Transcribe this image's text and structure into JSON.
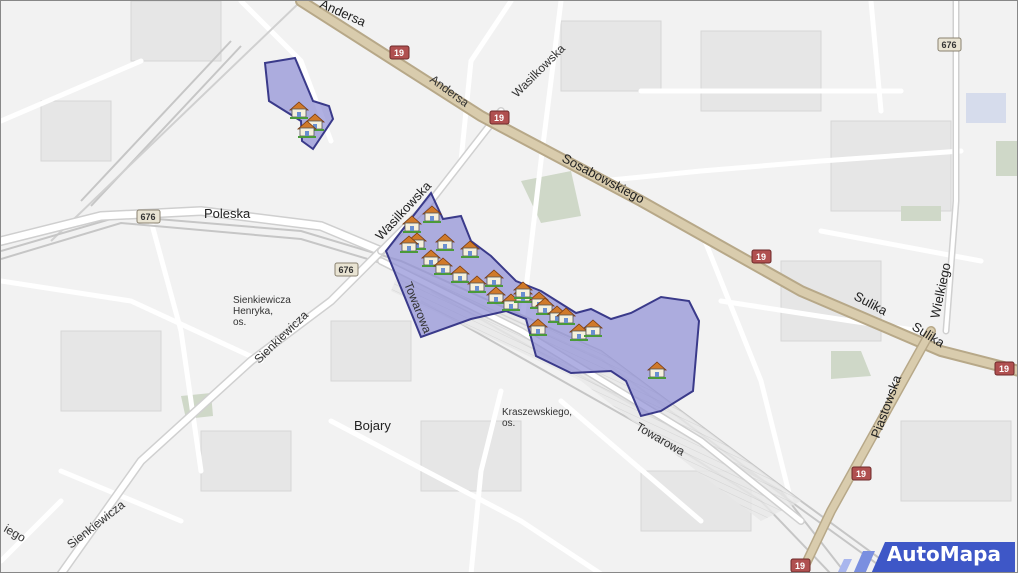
{
  "streets": {
    "andersa_top": "Andersa",
    "andersa": "Andersa",
    "wasilkowska_top": "Wasilkowska",
    "wasilkowska": "Wasilkowska",
    "sosabowskiego": "Sosabowskiego",
    "poleska": "Poleska",
    "sienkiewicza_mid": "Sienkiewicza",
    "sienkiewicza_low": "Sienkiewicza",
    "sienkiewicza_left": "iego",
    "towarowa_mid": "Towarowa",
    "towarowa": "Towarowa",
    "sulika_1": "Sulika",
    "sulika_2": "Sulika",
    "wielkiego": "Wielkiego",
    "piastowska": "Piastowska"
  },
  "places": {
    "sienkiewicza_line1": "Sienkiewicza",
    "sienkiewicza_line2": "Henryka,",
    "sienkiewicza_line3": "os.",
    "kraszewskiego_line1": "Kraszewskiego,",
    "kraszewskiego_line2": "os.",
    "bojary": "Bojary"
  },
  "road_shields": {
    "r676_top": "676",
    "r676_left": "676",
    "r676_mid": "676",
    "r19_a": "19",
    "r19_b": "19",
    "r19_c": "19",
    "r19_d": "19",
    "r19_e": "19",
    "r19_f": "19"
  },
  "colors": {
    "highlight_fill": "#8f8fd6",
    "highlight_stroke": "#3a3a8a",
    "main_road": "#c9b89a",
    "shield_national": "#b05050",
    "shield_regional": "#e9e4d3",
    "logo_bg": "#3e57c7"
  },
  "markers": {
    "icon": "house-icon",
    "count": 26
  },
  "logo": "AutoMapa"
}
